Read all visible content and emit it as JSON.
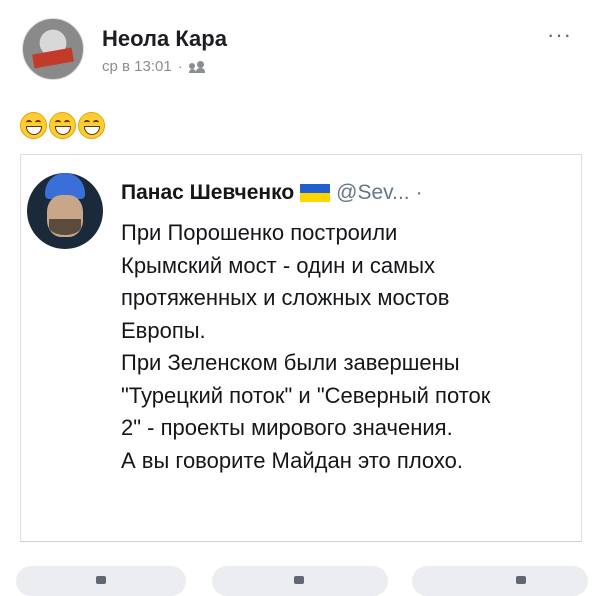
{
  "post": {
    "author": "Неола Кара",
    "timestamp": "ср в 13:01",
    "separator": "·",
    "more": "···",
    "emoji_count": 3
  },
  "tweet": {
    "author": "Панас Шевченко",
    "handle": "@Sev...",
    "separator": "·",
    "lines": [
      "При Порошенко построили",
      "Крымский мост - один и самых",
      "протяженных и сложных мостов",
      "Европы.",
      "При Зеленском были завершены",
      "\"Турецкий поток\" и \"Северный поток",
      "2\" - проекты мирового значения.",
      "А вы говорите Майдан это плохо."
    ]
  },
  "icons": {
    "avatar": "profile-photo",
    "audience": "friends-icon",
    "emoji": "grinning-face-emoji",
    "flag": "ukraine-flag-icon"
  }
}
